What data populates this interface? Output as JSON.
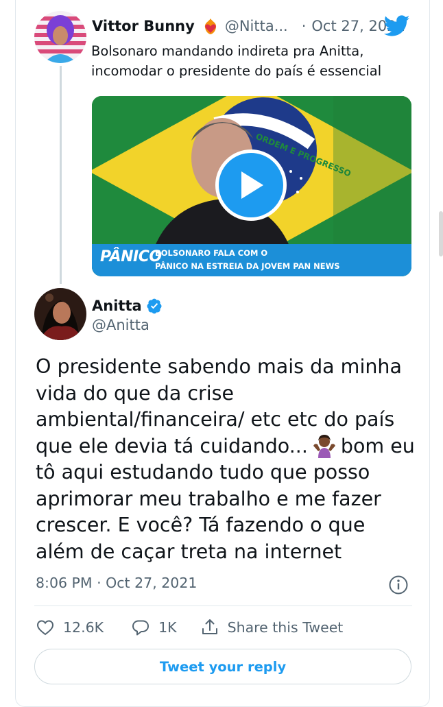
{
  "quoted_tweet": {
    "display_name": "Vittor Bunny",
    "handle": "@Nitta...",
    "separator": "·",
    "date": "Oct 27, 2021",
    "text": "Bolsonaro mandando indireta pra Anitta, incomodar o presidente do país é essencial",
    "name_emoji": "heart-on-fire-emoji",
    "video": {
      "flag_band_text": "ORDEM E PROGRESSO",
      "banner_logo": "PÂNICO",
      "banner_line1": "BOLSONARO FALA COM O",
      "banner_line2": "PÂNICO NA ESTREIA DA JOVEM PAN NEWS",
      "play_icon": "play-icon"
    }
  },
  "main_tweet": {
    "display_name": "Anitta",
    "handle": "@Anitta",
    "verified_icon": "verified-badge-icon",
    "text_part1": "O presidente sabendo mais da minha\nvida do que da crise\nambiental/financeira/ etc etc do país\nque ele devia tá cuidando...",
    "text_part2": "bom eu\ntô aqui estudando tudo que posso\naprimorar meu trabalho e me fazer\ncrescer. E você? Tá fazendo o que\nalém de caçar treta na internet",
    "emoji": "woman-shrugging-emoji",
    "timestamp": "8:06 PM · Oct 27, 2021"
  },
  "actions": {
    "likes": "12.6K",
    "replies": "1K",
    "share_label": "Share this Tweet"
  },
  "reply_button": "Tweet your reply",
  "colors": {
    "accent": "#1d9bf0",
    "secondary_text": "#536471",
    "border": "#e1e8ed"
  }
}
